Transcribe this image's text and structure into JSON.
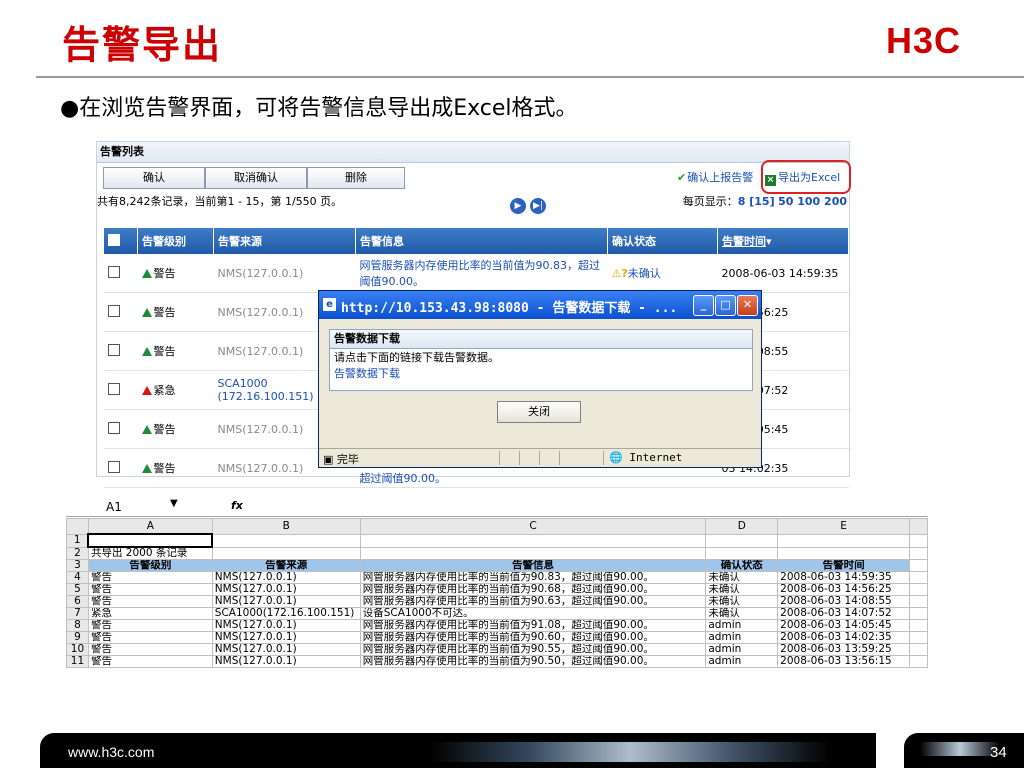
{
  "slide": {
    "title": "告警导出",
    "logo": "H3C",
    "bullet": "●在浏览告警界面，可将告警信息导出成Excel格式。",
    "footer_url": "www.h3c.com",
    "page_number": "34"
  },
  "alarm_panel": {
    "title": "告警列表",
    "buttons": {
      "confirm": "确认",
      "cancel_confirm": "取消确认",
      "delete": "删除"
    },
    "confirm_report_link": "确认上报告警",
    "export_link": "导出为Excel",
    "record_summary": "共有8,242条记录，当前第1 - 15，第 1/550 页。",
    "per_page_label": "每页显示：",
    "per_page_current": "8 [15]",
    "per_page_options": "50 100 200",
    "columns": {
      "level": "告警级别",
      "source": "告警来源",
      "info": "告警信息",
      "status": "确认状态",
      "time": "告警时间"
    },
    "sort_indicator": "▾",
    "rows": [
      {
        "level": "警告",
        "source": "NMS(127.0.0.1)",
        "info": "网管服务器内存使用比率的当前值为90.83，超过阈值90.00。",
        "status": "未确认",
        "time": "2008-06-03 14:59:35"
      },
      {
        "level": "警告",
        "source": "NMS(127.0.0.1)",
        "info": "",
        "status": "",
        "time": "03 14:56:25"
      },
      {
        "level": "警告",
        "source": "NMS(127.0.0.1)",
        "info": "",
        "status": "",
        "time": "03 14:08:55"
      },
      {
        "level": "紧急",
        "source": "SCA1000 (172.16.100.151)",
        "info": "",
        "status": "",
        "time": "03 14:07:52"
      },
      {
        "level": "警告",
        "source": "NMS(127.0.0.1)",
        "info": "",
        "status": "",
        "time": "03 14:05:45"
      },
      {
        "level": "警告",
        "source": "NMS(127.0.0.1)",
        "info": "超过阈值90.00。",
        "status": "",
        "time": "03 14:02:35"
      }
    ]
  },
  "popup": {
    "title": "http://10.153.43.98:8080 - 告警数据下载 - ...",
    "section_header": "告警数据下载",
    "message": "请点击下面的链接下载告警数据。",
    "download_link": "告警数据下载",
    "close_button": "关闭",
    "status_done": "完毕",
    "status_zone": "Internet"
  },
  "excel": {
    "name_box": "A1",
    "fx_label": "fx",
    "columns": [
      "A",
      "B",
      "C",
      "D",
      "E"
    ],
    "row_numbers": [
      "1",
      "2",
      "3",
      "4",
      "5",
      "6",
      "7",
      "8",
      "9",
      "10",
      "11"
    ],
    "summary": "共导出 2000 条记录",
    "headers": [
      "告警级别",
      "告警来源",
      "告警信息",
      "确认状态",
      "告警时间"
    ],
    "rows": [
      [
        "警告",
        "NMS(127.0.0.1)",
        "网管服务器内存使用比率的当前值为90.83，超过阈值90.00。",
        "未确认",
        "2008-06-03 14:59:35"
      ],
      [
        "警告",
        "NMS(127.0.0.1)",
        "网管服务器内存使用比率的当前值为90.68，超过阈值90.00。",
        "未确认",
        "2008-06-03 14:56:25"
      ],
      [
        "警告",
        "NMS(127.0.0.1)",
        "网管服务器内存使用比率的当前值为90.63，超过阈值90.00。",
        "未确认",
        "2008-06-03 14:08:55"
      ],
      [
        "紧急",
        "SCA1000(172.16.100.151)",
        "设备SCA1000不可达。",
        "未确认",
        "2008-06-03 14:07:52"
      ],
      [
        "警告",
        "NMS(127.0.0.1)",
        "网管服务器内存使用比率的当前值为91.08，超过阈值90.00。",
        "admin",
        "2008-06-03 14:05:45"
      ],
      [
        "警告",
        "NMS(127.0.0.1)",
        "网管服务器内存使用比率的当前值为90.60，超过阈值90.00。",
        "admin",
        "2008-06-03 14:02:35"
      ],
      [
        "警告",
        "NMS(127.0.0.1)",
        "网管服务器内存使用比率的当前值为90.55，超过阈值90.00。",
        "admin",
        "2008-06-03 13:59:25"
      ],
      [
        "警告",
        "NMS(127.0.0.1)",
        "网管服务器内存使用比率的当前值为90.50，超过阈值90.00。",
        "admin",
        "2008-06-03 13:56:15"
      ]
    ]
  },
  "colors": {
    "title_red": "#cc0000",
    "grid_header_blue": "#1f5aa8",
    "link_blue": "#1a4fb4"
  }
}
